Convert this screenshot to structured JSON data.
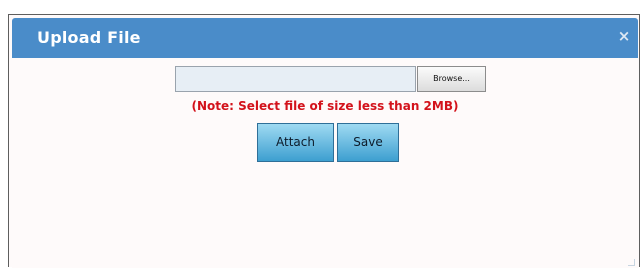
{
  "dialog": {
    "title": "Upload File",
    "close_glyph": "×",
    "file_input": {
      "value": "",
      "browse_label": "Browse..."
    },
    "note": "(Note: Select file of size less than 2MB)",
    "buttons": {
      "attach_label": "Attach",
      "save_label": "Save"
    }
  },
  "colors": {
    "titlebar": "#4a8cc9",
    "note_text": "#d3121b",
    "button_gradient_top": "#9fdaf2",
    "button_gradient_bottom": "#3d9fd0"
  },
  "icons": [
    "close-icon",
    "resize-grip-icon"
  ]
}
